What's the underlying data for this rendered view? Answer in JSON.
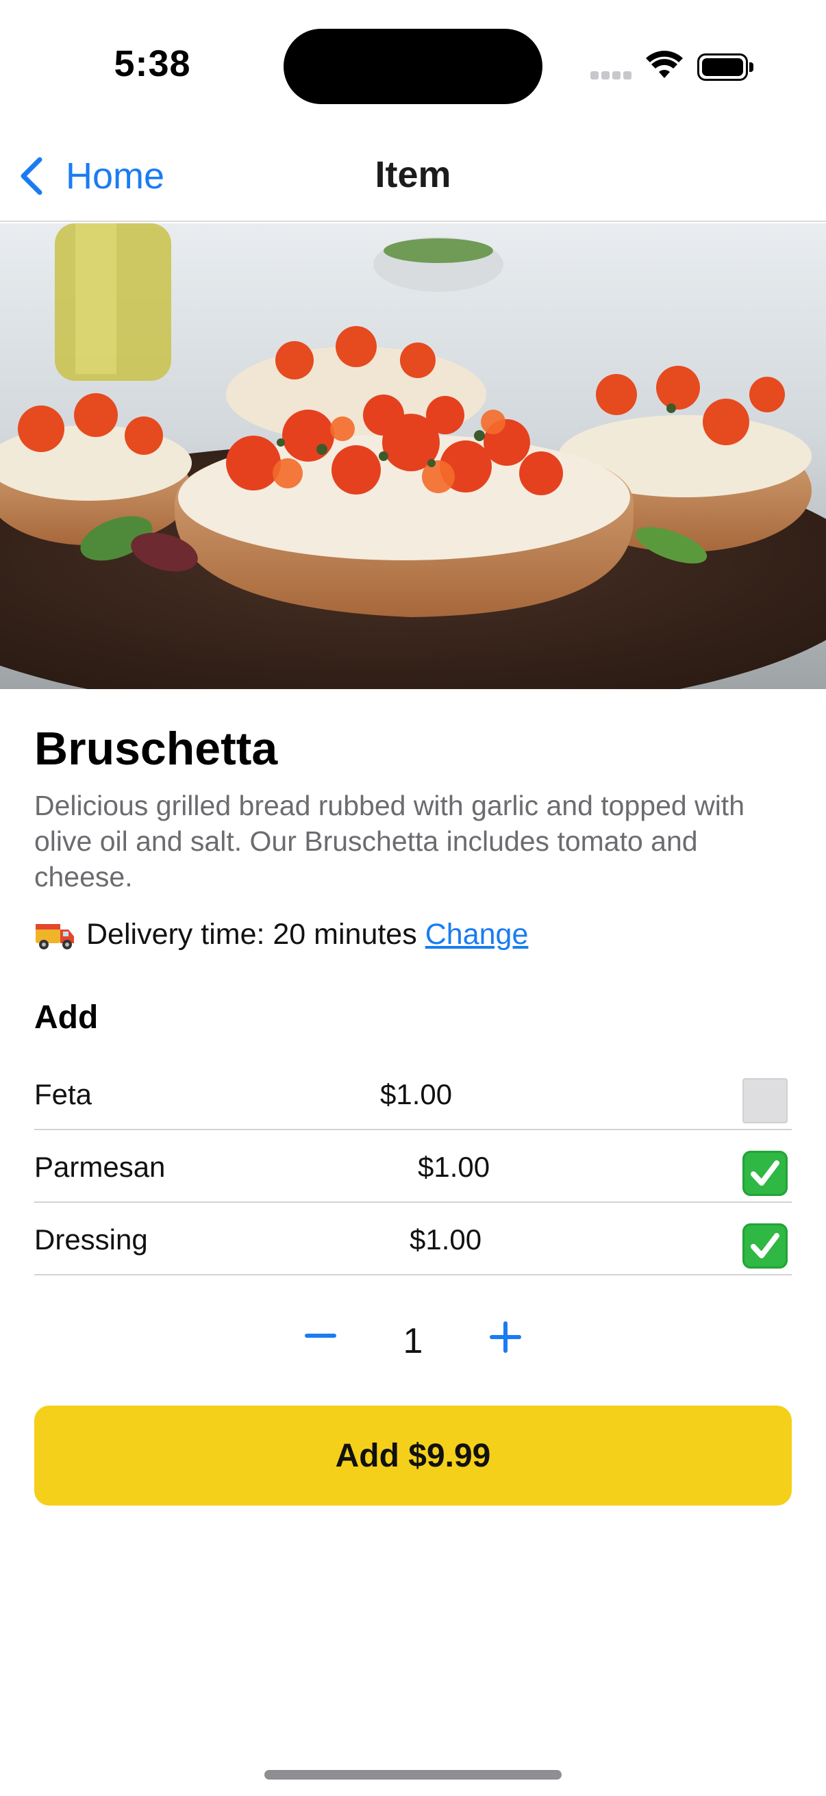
{
  "status_bar": {
    "time": "5:38"
  },
  "nav": {
    "back_label": "Home",
    "title": "Item"
  },
  "hero": {
    "image_description": "bruschetta-photo"
  },
  "item": {
    "title": "Bruschetta",
    "description": "Delicious grilled bread rubbed with garlic and topped with olive oil and salt. Our Bruschetta includes tomato and cheese.",
    "delivery_prefix": "Delivery time: 20 minutes",
    "delivery_change": "Change"
  },
  "addons": {
    "heading": "Add",
    "items": [
      {
        "name": "Feta",
        "price": "$1.00",
        "checked": false
      },
      {
        "name": "Parmesan",
        "price": "$1.00",
        "checked": true
      },
      {
        "name": "Dressing",
        "price": "$1.00",
        "checked": true
      }
    ]
  },
  "stepper": {
    "quantity": "1"
  },
  "add_button": {
    "label": "Add $9.99"
  },
  "colors": {
    "accent": "#1a7cf2",
    "button": "#f4d01b",
    "checked": "#2fb844"
  },
  "icons": {
    "back": "chevron-left-icon",
    "truck": "delivery-truck-icon",
    "minus": "minus-icon",
    "plus": "plus-icon",
    "check": "checkmark-icon"
  }
}
